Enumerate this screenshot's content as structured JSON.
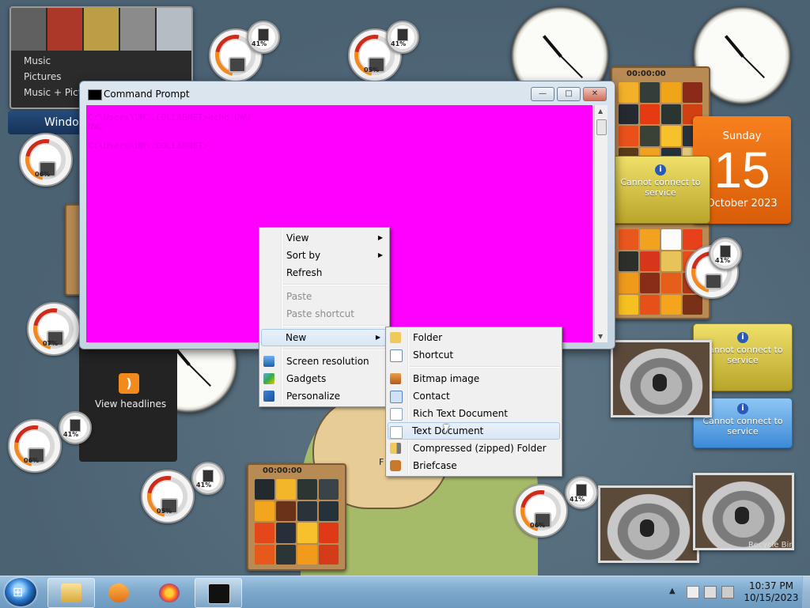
{
  "media_gadget": {
    "items": [
      "Music",
      "Pictures",
      "Music + Pict"
    ],
    "tab_label": "Windo"
  },
  "meters": [
    {
      "pct1": "05%",
      "pct2": "41%"
    },
    {
      "pct1": "",
      "pct2": "41%"
    },
    {
      "pct1": "06%",
      "pct2": ""
    },
    {
      "pct1": "07%",
      "pct2": ""
    },
    {
      "pct1": "06%",
      "pct2": "41%"
    },
    {
      "pct1": "05%",
      "pct2": "41%"
    },
    {
      "pct1": "06%",
      "pct2": "41%"
    },
    {
      "pct1": "",
      "pct2": "41%"
    }
  ],
  "puzzles": [
    {
      "time": "00:00:00"
    },
    {
      "time": "00:00:00"
    }
  ],
  "calendar": {
    "day": "Sunday",
    "date": "15",
    "month": "October 2023"
  },
  "weather": {
    "message_1": "Cannot connect to service",
    "message_2": "Cannot connect to service",
    "message_3": "Cannot connect to service"
  },
  "feed": {
    "label": "View headlines"
  },
  "cmd_window": {
    "title": "Command Prompt",
    "lines": "C:\\Users\\UM1.COLLABNET>echo UWU\nUWU\n\nC:\\Users\\UM1.COLLABNET>",
    "btn_min": "—",
    "btn_max": "□",
    "btn_close": "✕"
  },
  "context_menu": {
    "view": "View",
    "sort_by": "Sort by",
    "refresh": "Refresh",
    "paste": "Paste",
    "paste_shortcut": "Paste shortcut",
    "new": "New",
    "screen_resolution": "Screen resolution",
    "gadgets": "Gadgets",
    "personalize": "Personalize"
  },
  "new_submenu": {
    "folder": "Folder",
    "shortcut": "Shortcut",
    "bitmap": "Bitmap image",
    "contact": "Contact",
    "rich_text": "Rich Text Document",
    "text_doc": "Text Document",
    "zipped": "Compressed (zipped) Folder",
    "briefcase": "Briefcase"
  },
  "desktop_labels": {
    "recycle": "Recycle Bin",
    "partial_f": "F"
  },
  "taskbar": {
    "start_glyph": "⊞",
    "time": "10:37 PM",
    "date": "10/15/2023",
    "tray_up": "▲"
  },
  "colors": {
    "console_bg": "#ff00ff",
    "taskbar": "#7ea9cc",
    "calendar": "#f07517"
  }
}
